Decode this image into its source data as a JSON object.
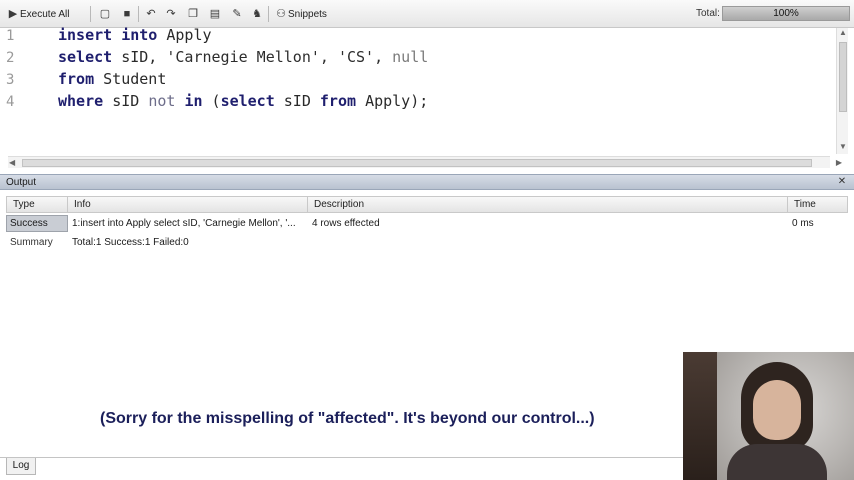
{
  "toolbar": {
    "execute_all_label": "Execute All",
    "snippets_label": "Snippets",
    "total_label": "Total:",
    "total_progress_text": "100%",
    "total_progress_fraction": 1.0
  },
  "editor": {
    "line_numbers": [
      "1",
      "2",
      "3",
      "4"
    ],
    "lines": [
      [
        {
          "t": "insert into ",
          "c": "kw"
        },
        {
          "t": "Apply",
          "c": "id"
        }
      ],
      [
        {
          "t": "select ",
          "c": "kw"
        },
        {
          "t": "sID, ",
          "c": "id"
        },
        {
          "t": "'Carnegie Mellon', 'CS', ",
          "c": "str"
        },
        {
          "t": "null",
          "c": "null"
        }
      ],
      [
        {
          "t": "from ",
          "c": "kw"
        },
        {
          "t": "Student",
          "c": "id"
        }
      ],
      [
        {
          "t": "where ",
          "c": "kw"
        },
        {
          "t": "sID ",
          "c": "id"
        },
        {
          "t": "not ",
          "c": "kw2"
        },
        {
          "t": "in ",
          "c": "kw"
        },
        {
          "t": "(",
          "c": "id"
        },
        {
          "t": "select ",
          "c": "kw"
        },
        {
          "t": "sID ",
          "c": "id"
        },
        {
          "t": "from ",
          "c": "kw"
        },
        {
          "t": "Apply);",
          "c": "id"
        }
      ]
    ]
  },
  "output": {
    "title": "Output",
    "columns": [
      "Type",
      "Info",
      "Description",
      "Time"
    ],
    "rows": [
      {
        "type": "Success",
        "info": "1:insert into Apply select sID, 'Carnegie Mellon', '...",
        "description": "4 rows effected",
        "time": "0 ms"
      },
      {
        "type": "Summary",
        "info": "Total:1 Success:1 Failed:0",
        "description": "",
        "time": ""
      }
    ]
  },
  "caption": "(Sorry for the misspelling of \"affected\". It's beyond our control...)",
  "bottom_tab": "Log"
}
